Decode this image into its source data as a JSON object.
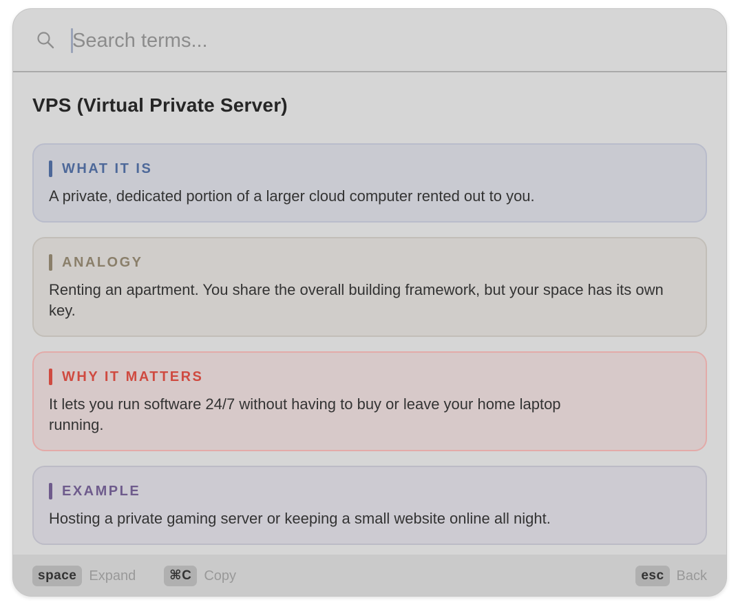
{
  "search": {
    "placeholder": "Search terms...",
    "value": ""
  },
  "term": {
    "title": "VPS (Virtual Private Server)"
  },
  "sections": {
    "what_it_is": {
      "label": "WHAT IT IS",
      "text": "A private, dedicated portion of a larger cloud computer rented out to you.",
      "accent": "#4d6899"
    },
    "analogy": {
      "label": "ANALOGY",
      "text": "Renting an apartment. You share the overall building framework, but your space has its own key.",
      "accent": "#8a7f6a"
    },
    "why_it_matters": {
      "label": "WHY IT MATTERS",
      "text": "It lets you run software 24/7 without having to buy or leave your home laptop running.",
      "accent": "#cf4a40"
    },
    "example": {
      "label": "EXAMPLE",
      "text": "Hosting a private gaming server or keeping a small website online all night.",
      "accent": "#6e5b8c"
    }
  },
  "footer": {
    "expand": {
      "key": "space",
      "label": "Expand"
    },
    "copy": {
      "key": "⌘C",
      "label": "Copy"
    },
    "back": {
      "key": "esc",
      "label": "Back"
    }
  },
  "icons": {
    "search": "search-icon"
  }
}
